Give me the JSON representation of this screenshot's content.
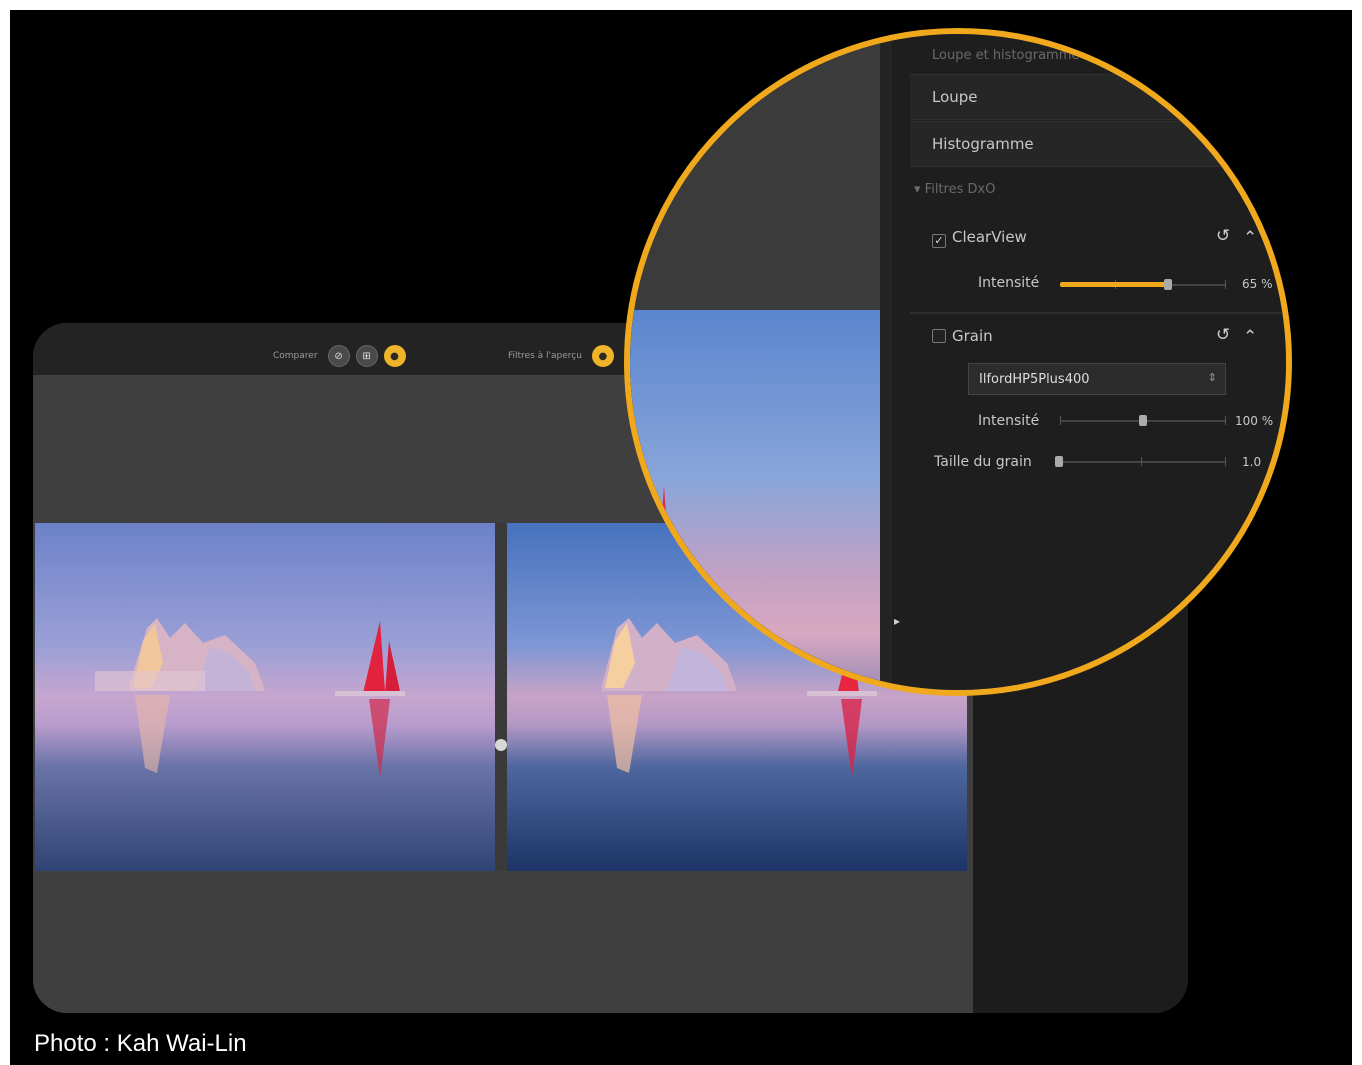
{
  "toolbar": {
    "compare_label": "Comparer",
    "compare_btn_1": "⊘",
    "compare_btn_2": "⊞",
    "compare_btn_3": "●",
    "preview_label": "Filtres à l'aperçu",
    "preview_btn": "●"
  },
  "panel": {
    "section_loupe_histo": "Loupe et histogramme",
    "loupe_label": "Loupe",
    "histogram_label": "Histogramme",
    "section_filters": "Filtres DxO",
    "clearview": {
      "checked_mark": "✓",
      "label": "ClearView",
      "reset_icon": "↺",
      "collapse_icon": "⌃",
      "intensity_label": "Intensité",
      "intensity_value_text": "65 %",
      "intensity_value": 65
    },
    "grain": {
      "label": "Grain",
      "reset_icon": "↺",
      "collapse_icon": "⌃",
      "film_selected": "IlfordHP5Plus400",
      "film_chevron": "⇕",
      "intensity_label": "Intensité",
      "intensity_value_text": "100 %",
      "intensity_value": 100,
      "size_label": "Taille du grain",
      "size_value_text": "1.0",
      "size_value": 1.0
    },
    "side_arrow": "▸"
  },
  "caption": {
    "text": "Photo :  Kah Wai-Lin"
  },
  "colors": {
    "accent": "#f0a81c",
    "panel_bg": "#1e1e1e",
    "viewer_bg": "#3f3f3f"
  }
}
